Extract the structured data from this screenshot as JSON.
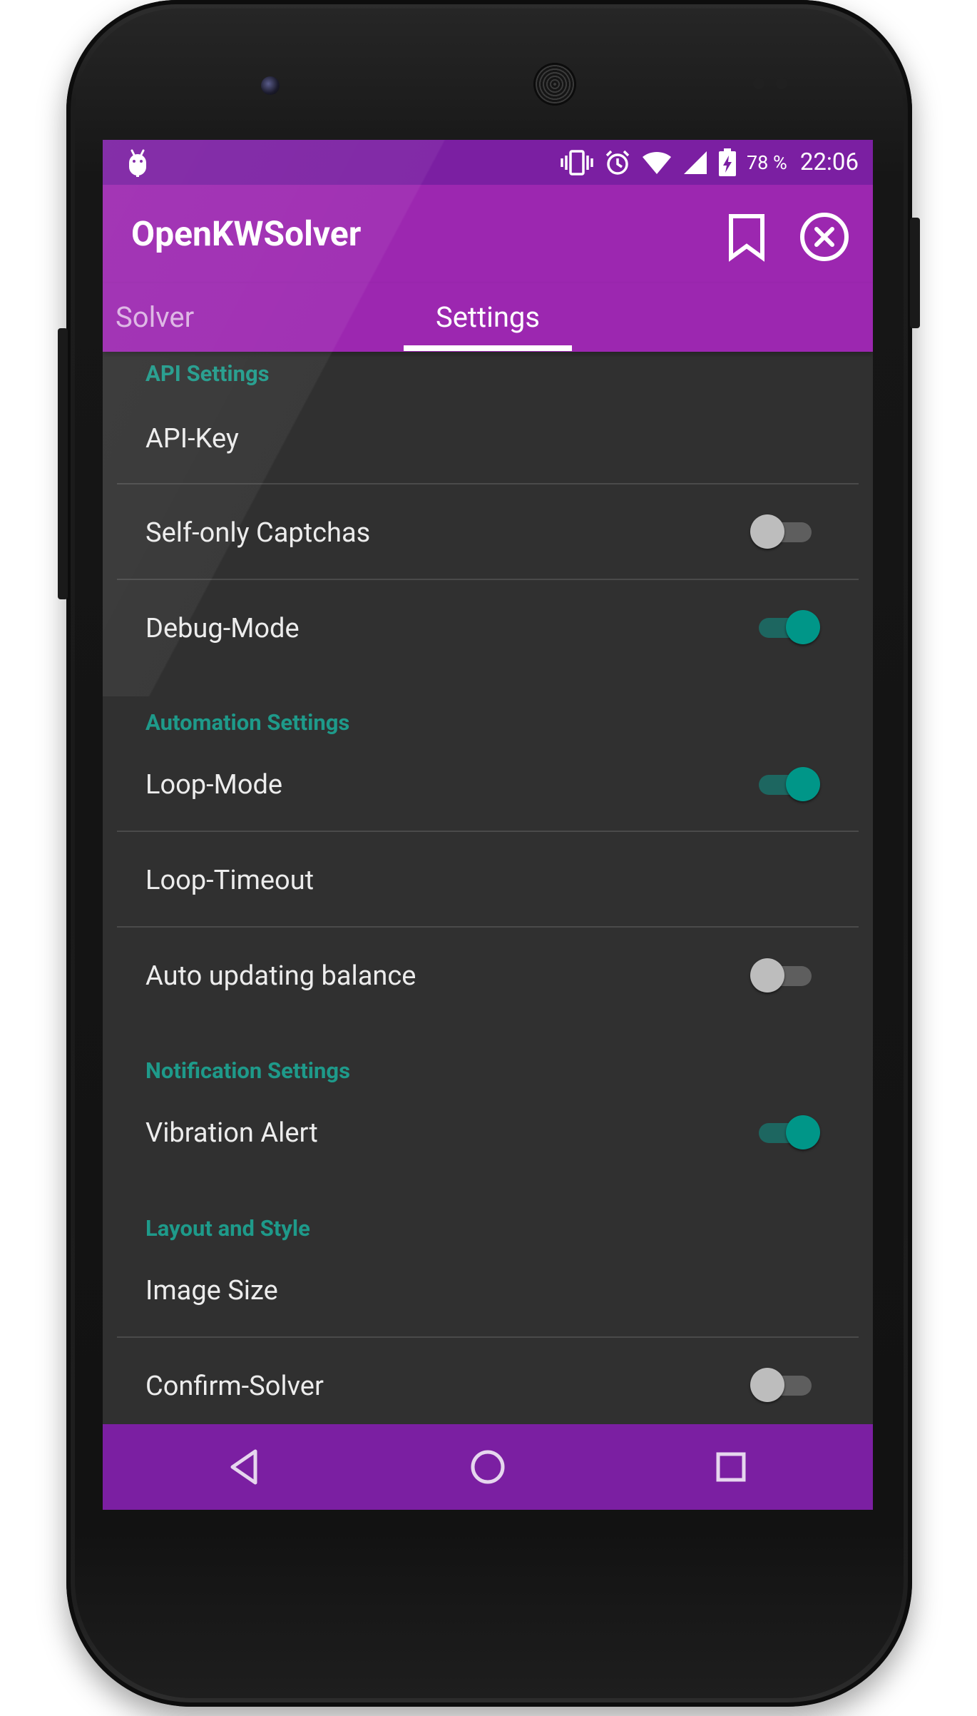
{
  "status_bar": {
    "battery": "78 %",
    "time": "22:06"
  },
  "app_bar": {
    "title": "OpenKWSolver"
  },
  "tabs": [
    {
      "label": "Solver",
      "selected": false
    },
    {
      "label": "Settings",
      "selected": true
    }
  ],
  "settings": {
    "api_section": "API Settings",
    "api_key": "API-Key",
    "self_only_captchas": {
      "label": "Self-only Captchas",
      "enabled": false
    },
    "debug_mode": {
      "label": "Debug-Mode",
      "enabled": true
    },
    "automation_section": "Automation Settings",
    "loop_mode": {
      "label": "Loop-Mode",
      "enabled": true
    },
    "loop_timeout": "Loop-Timeout",
    "auto_updating_balance": {
      "label": "Auto updating balance",
      "enabled": false
    },
    "notification_section": "Notification Settings",
    "vibration_alert": {
      "label": "Vibration Alert",
      "enabled": true
    },
    "layout_section": "Layout and Style",
    "image_size": "Image Size",
    "confirm_solver": {
      "label": "Confirm-Solver",
      "enabled": false
    }
  },
  "colors": {
    "primary": "#9c27b0",
    "primary_dark": "#7b1fa2",
    "accent": "#009688",
    "background": "#303030"
  },
  "icons": {
    "status": [
      "android-debug-icon",
      "vibrate-icon",
      "alarm-icon",
      "wifi-icon",
      "signal-icon",
      "battery-charging-icon"
    ],
    "app_bar": [
      "bookmark-icon",
      "close-circle-icon"
    ],
    "nav": [
      "back-icon",
      "home-icon",
      "recents-icon"
    ]
  }
}
